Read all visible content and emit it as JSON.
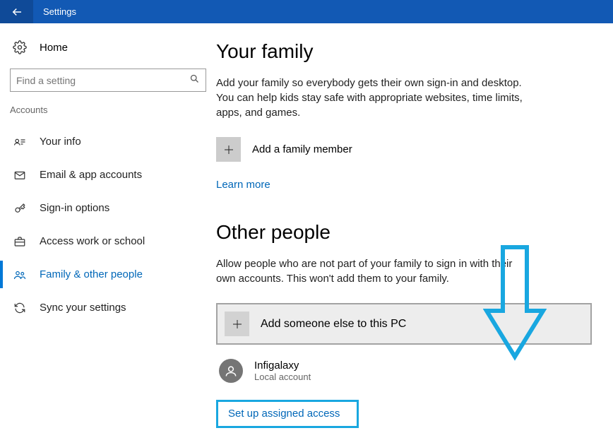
{
  "titlebar": {
    "title": "Settings"
  },
  "sidebar": {
    "home": "Home",
    "search_placeholder": "Find a setting",
    "section": "Accounts",
    "items": [
      {
        "label": "Your info"
      },
      {
        "label": "Email & app accounts"
      },
      {
        "label": "Sign-in options"
      },
      {
        "label": "Access work or school"
      },
      {
        "label": "Family & other people"
      },
      {
        "label": "Sync your settings"
      }
    ]
  },
  "main": {
    "family": {
      "heading": "Your family",
      "desc": "Add your family so everybody gets their own sign-in and desktop. You can help kids stay safe with appropriate websites, time limits, apps, and games.",
      "add_label": "Add a family member",
      "learn_more": "Learn more"
    },
    "other": {
      "heading": "Other people",
      "desc": "Allow people who are not part of your family to sign in with their own accounts. This won't add them to your family.",
      "add_label": "Add someone else to this PC",
      "user": {
        "name": "Infigalaxy",
        "type": "Local account"
      },
      "assigned": "Set up assigned access"
    }
  }
}
